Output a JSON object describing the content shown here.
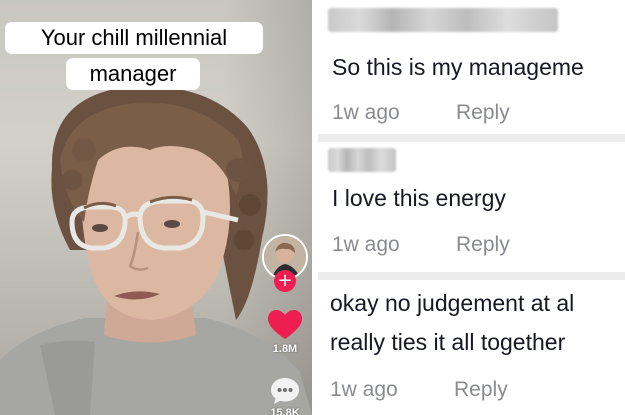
{
  "video": {
    "caption_line_1": "Your chill millennial",
    "caption_line_2": "manager",
    "like_count": "1.8M",
    "comment_count": "15.8K",
    "icons": {
      "avatar": "creator-avatar",
      "follow": "plus-icon",
      "like": "heart-icon",
      "comment": "comment-bubble-icon"
    },
    "colors": {
      "like": "#ee1d52",
      "follow": "#ee1d52"
    }
  },
  "comments": [
    {
      "username_hidden": true,
      "text": "So this is my manageme",
      "time": "1w ago",
      "reply_label": "Reply"
    },
    {
      "username_hidden": true,
      "text": "I love this energy",
      "time": "1w ago",
      "reply_label": "Reply"
    },
    {
      "username_hidden": true,
      "text_line_1": "okay no judgement at al",
      "text_line_2": "really ties it all together",
      "time": "1w ago",
      "reply_label": "Reply"
    }
  ],
  "colors": {
    "comment_text": "#161823",
    "meta_text": "#8a8b91",
    "separator": "#ececec"
  }
}
